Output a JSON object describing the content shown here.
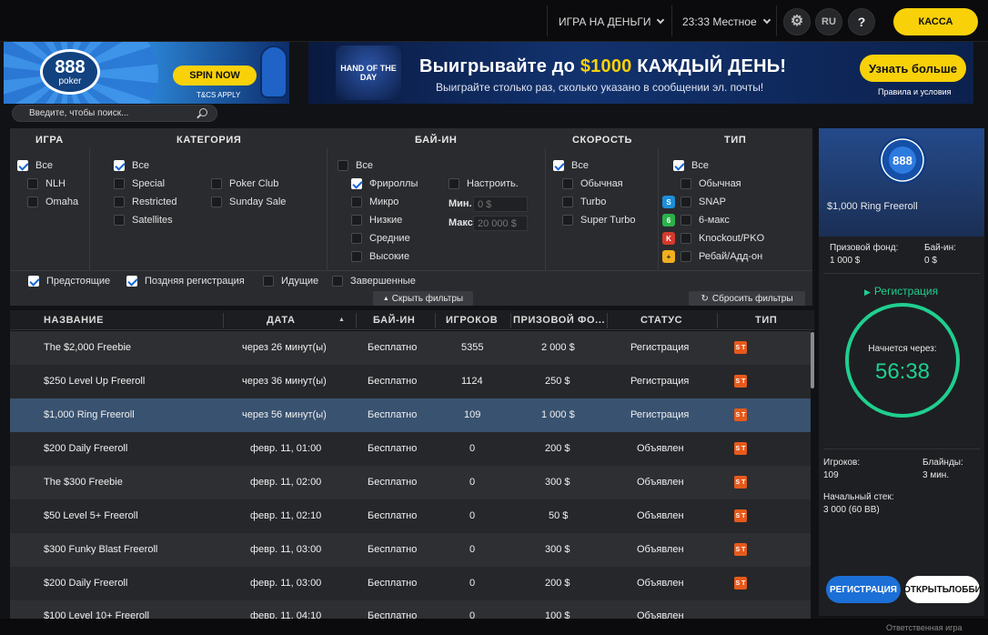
{
  "topbar": {
    "mode": "ИГРА НА ДЕНЬГИ",
    "time": "23:33 Местное",
    "lang": "RU",
    "help": "?",
    "cashier": "КАССА"
  },
  "banner1": {
    "logo_number": "888",
    "logo_text": "poker",
    "cta": "SPIN NOW",
    "tcs": "T&CS APPLY"
  },
  "banner2": {
    "logo_text": "HAND OF THE DAY",
    "title_pre": "Выигрывайте до ",
    "title_amount": "$1000",
    "title_post": " КАЖДЫЙ ДЕНЬ!",
    "subtitle": "Выиграйте столько раз, сколько указано в сообщении эл. почты!",
    "cta": "Узнать больше",
    "rules": "Правила и условия"
  },
  "search": {
    "placeholder": "Введите, чтобы поиск..."
  },
  "filters": {
    "headers": {
      "game": "ИГРА",
      "category": "КАТЕГОРИЯ",
      "buyin": "БАЙ-ИН",
      "speed": "СКОРОСТЬ",
      "type": "ТИП"
    },
    "game": [
      {
        "label": "Все",
        "checked": true
      },
      {
        "label": "NLH",
        "checked": false
      },
      {
        "label": "Omaha",
        "checked": false
      }
    ],
    "category": [
      {
        "label": "Все",
        "checked": true
      },
      {
        "label": "Special",
        "checked": false
      },
      {
        "label": "Restricted",
        "checked": false
      },
      {
        "label": "Satellites",
        "checked": false
      },
      {
        "label": "Poker Club",
        "checked": false
      },
      {
        "label": "Sunday Sale",
        "checked": false
      }
    ],
    "buyin": [
      {
        "label": "Все",
        "checked": false
      },
      {
        "label": "Фрироллы",
        "checked": true
      },
      {
        "label": "Микро",
        "checked": false
      },
      {
        "label": "Низкие",
        "checked": false
      },
      {
        "label": "Средние",
        "checked": false
      },
      {
        "label": "Высокие",
        "checked": false
      }
    ],
    "buyin_custom": {
      "label": "Настроить.",
      "min_label": "Мин.",
      "min_placeholder": "0 $",
      "max_label": "Макс.",
      "max_placeholder": "20 000 $"
    },
    "speed": [
      {
        "label": "Все",
        "checked": true
      },
      {
        "label": "Обычная",
        "checked": false
      },
      {
        "label": "Turbo",
        "checked": false
      },
      {
        "label": "Super Turbo",
        "checked": false
      }
    ],
    "type": [
      {
        "label": "Все",
        "checked": true
      },
      {
        "label": "Обычная",
        "checked": false
      },
      {
        "label": "SNAP",
        "checked": false
      },
      {
        "label": "6-макс",
        "checked": false
      },
      {
        "label": "Knockout/PKO",
        "checked": false
      },
      {
        "label": "Ребай/Адд-он",
        "checked": false
      }
    ],
    "status": [
      {
        "label": "Предстоящие",
        "checked": true
      },
      {
        "label": "Поздняя регистрация",
        "checked": true
      },
      {
        "label": "Идущие",
        "checked": false
      },
      {
        "label": "Завершенные",
        "checked": false
      }
    ],
    "hide_filters": "Скрыть фильтры",
    "reset_filters": "Сбросить фильтры"
  },
  "table": {
    "columns": [
      "НАЗВАНИЕ",
      "ДАТА",
      "БАЙ-ИН",
      "ИГРОКОВ",
      "ПРИЗОВОЙ ФО...",
      "СТАТУС",
      "ТИП"
    ],
    "type_badge": "S T",
    "rows": [
      {
        "name": "The $2,000 Freebie",
        "date": "через 26 минут(ы)",
        "buyin": "Бесплатно",
        "players": "5355",
        "prize": "2 000 $",
        "status": "Регистрация"
      },
      {
        "name": "$250 Level Up Freeroll",
        "date": "через 36 минут(ы)",
        "buyin": "Бесплатно",
        "players": "1124",
        "prize": "250 $",
        "status": "Регистрация"
      },
      {
        "name": "$1,000 Ring Freeroll",
        "date": "через 56 минут(ы)",
        "buyin": "Бесплатно",
        "players": "109",
        "prize": "1 000 $",
        "status": "Регистрация"
      },
      {
        "name": "$200 Daily Freeroll",
        "date": "февр. 11, 01:00",
        "buyin": "Бесплатно",
        "players": "0",
        "prize": "200 $",
        "status": "Объявлен"
      },
      {
        "name": "The $300 Freebie",
        "date": "февр. 11, 02:00",
        "buyin": "Бесплатно",
        "players": "0",
        "prize": "300 $",
        "status": "Объявлен"
      },
      {
        "name": "$50 Level 5+ Freeroll",
        "date": "февр. 11, 02:10",
        "buyin": "Бесплатно",
        "players": "0",
        "prize": "50 $",
        "status": "Объявлен"
      },
      {
        "name": "$300 Funky Blast Freeroll",
        "date": "февр. 11, 03:00",
        "buyin": "Бесплатно",
        "players": "0",
        "prize": "300 $",
        "status": "Объявлен"
      },
      {
        "name": "$200 Daily Freeroll",
        "date": "февр. 11, 03:00",
        "buyin": "Бесплатно",
        "players": "0",
        "prize": "200 $",
        "status": "Объявлен"
      },
      {
        "name": "$100 Level 10+ Freeroll",
        "date": "февр. 11, 04:10",
        "buyin": "Бесплатно",
        "players": "0",
        "prize": "100 $",
        "status": "Объявлен"
      }
    ]
  },
  "details": {
    "chip_text": "888",
    "title": "$1,000 Ring Freeroll",
    "prize_label": "Призовой фонд:",
    "prize_value": "1 000 $",
    "buyin_label": "Бай-ин:",
    "buyin_value": "0 $",
    "status": "Регистрация",
    "starts_label": "Начнется через:",
    "timer": "56:38",
    "players_label": "Игроков:",
    "players_value": "109",
    "blinds_label": "Блайнды:",
    "blinds_value": "3 мин.",
    "stack_label": "Начальный стек:",
    "stack_value": "3 000 (60 BB)",
    "register_button": "РЕГИСТРАЦИЯ",
    "lobby_button": "ОТКРЫТЬЛОББИ"
  },
  "footer": {
    "responsible": "Ответственная игра"
  }
}
